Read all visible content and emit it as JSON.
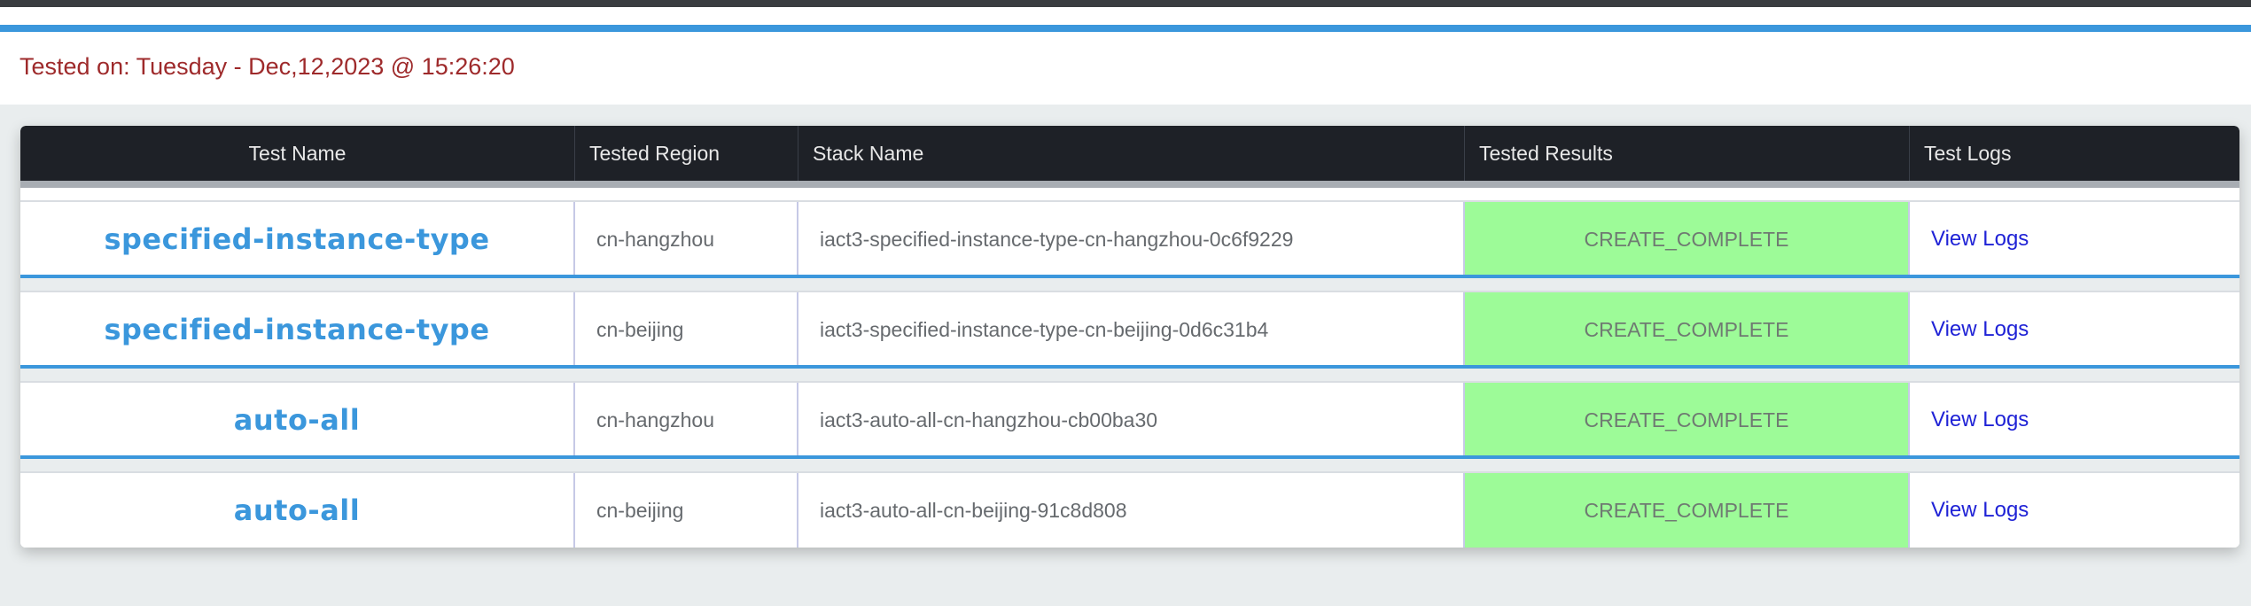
{
  "banner": {
    "tested_on": "Tested on: Tuesday - Dec,12,2023 @ 15:26:20"
  },
  "table": {
    "headers": [
      "Test Name",
      "Tested Region",
      "Stack Name",
      "Tested Results",
      "Test Logs"
    ],
    "rows": [
      {
        "test_name": "specified-instance-type",
        "region": "cn-hangzhou",
        "stack": "iact3-specified-instance-type-cn-hangzhou-0c6f9229",
        "result": "CREATE_COMPLETE",
        "logs": "View Logs"
      },
      {
        "test_name": "specified-instance-type",
        "region": "cn-beijing",
        "stack": "iact3-specified-instance-type-cn-beijing-0d6c31b4",
        "result": "CREATE_COMPLETE",
        "logs": "View Logs"
      },
      {
        "test_name": "auto-all",
        "region": "cn-hangzhou",
        "stack": "iact3-auto-all-cn-hangzhou-cb00ba30",
        "result": "CREATE_COMPLETE",
        "logs": "View Logs"
      },
      {
        "test_name": "auto-all",
        "region": "cn-beijing",
        "stack": "iact3-auto-all-cn-beijing-91c8d808",
        "result": "CREATE_COMPLETE",
        "logs": "View Logs"
      }
    ]
  },
  "colors": {
    "accent_blue": "#3b97dc",
    "banner_text": "#9e2a2b",
    "header_bg": "#1e2127",
    "result_success_bg": "#9dfb98",
    "link": "#1f22d6"
  }
}
